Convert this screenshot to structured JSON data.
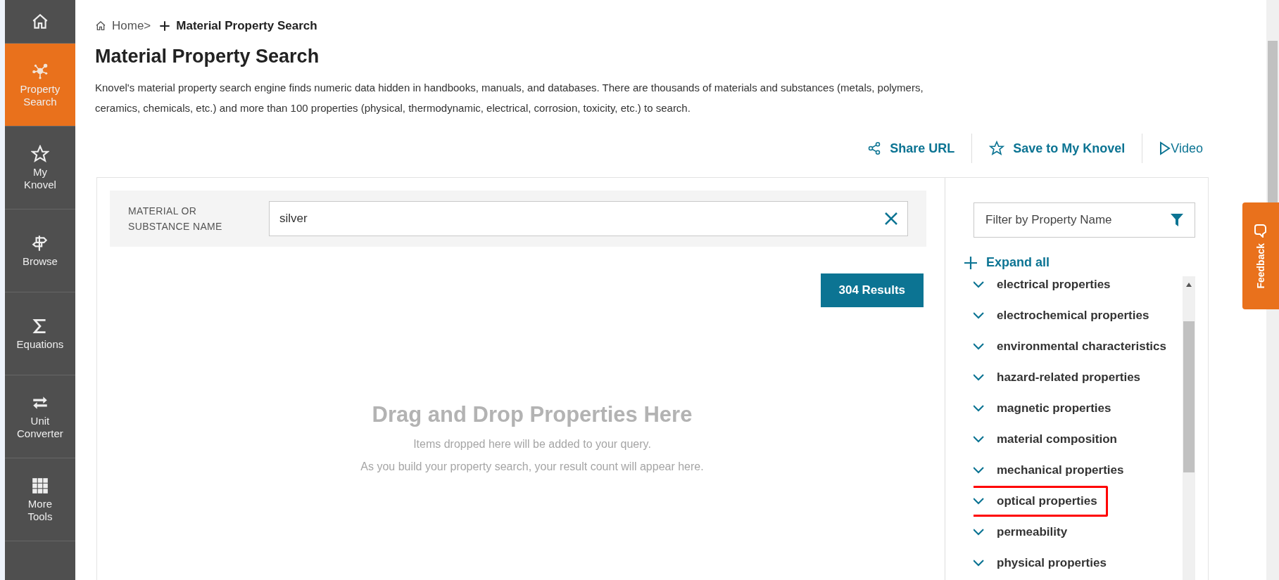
{
  "sidebar": {
    "items": [
      {
        "kind": "home",
        "selected": false
      },
      {
        "kind": "network",
        "label": "Property Search",
        "selected": true
      },
      {
        "kind": "star",
        "label": "My Knovel",
        "selected": false
      },
      {
        "kind": "signpost",
        "label": "Browse",
        "selected": false
      },
      {
        "kind": "sigma",
        "label": "Equations",
        "selected": false
      },
      {
        "kind": "arrows",
        "label": "Unit Converter",
        "selected": false
      },
      {
        "kind": "grid",
        "label": "More Tools",
        "selected": false
      }
    ]
  },
  "breadcrumb": {
    "home": "Home>",
    "current": "Material Property Search"
  },
  "title": "Material Property Search",
  "description": "Knovel's material property search engine finds numeric data hidden in handbooks, manuals, and databases. There are thousands of materials and substances (metals, polymers, ceramics, chemicals, etc.) and more than 100 properties (physical, thermodynamic, electrical, corrosion, toxicity, etc.) to search.",
  "actions": [
    {
      "kind": "share",
      "label": "Share URL"
    },
    {
      "kind": "star",
      "label": "Save to My Knovel"
    },
    {
      "kind": "play",
      "label": "Video"
    }
  ],
  "search": {
    "label": "MATERIAL OR SUBSTANCE NAME",
    "value": "silver"
  },
  "results": "304 Results",
  "dropzone": {
    "heading": "Drag and Drop Properties Here",
    "lines": [
      "Items dropped here will be added to your query.",
      "As you build your property search, your result count will appear here."
    ]
  },
  "filter": {
    "placeholder": "Filter by Property Name"
  },
  "expand_all": "Expand all",
  "properties": [
    {
      "label": "electrical properties",
      "highlighted": false
    },
    {
      "label": "electrochemical properties",
      "highlighted": false
    },
    {
      "label": "environmental characteristics",
      "highlighted": false
    },
    {
      "label": "hazard-related properties",
      "highlighted": false
    },
    {
      "label": "magnetic properties",
      "highlighted": false
    },
    {
      "label": "material composition",
      "highlighted": false
    },
    {
      "label": "mechanical properties",
      "highlighted": false
    },
    {
      "label": "optical properties",
      "highlighted": true
    },
    {
      "label": "permeability",
      "highlighted": false
    },
    {
      "label": "physical properties",
      "highlighted": false
    }
  ],
  "feedback": "Feedback"
}
